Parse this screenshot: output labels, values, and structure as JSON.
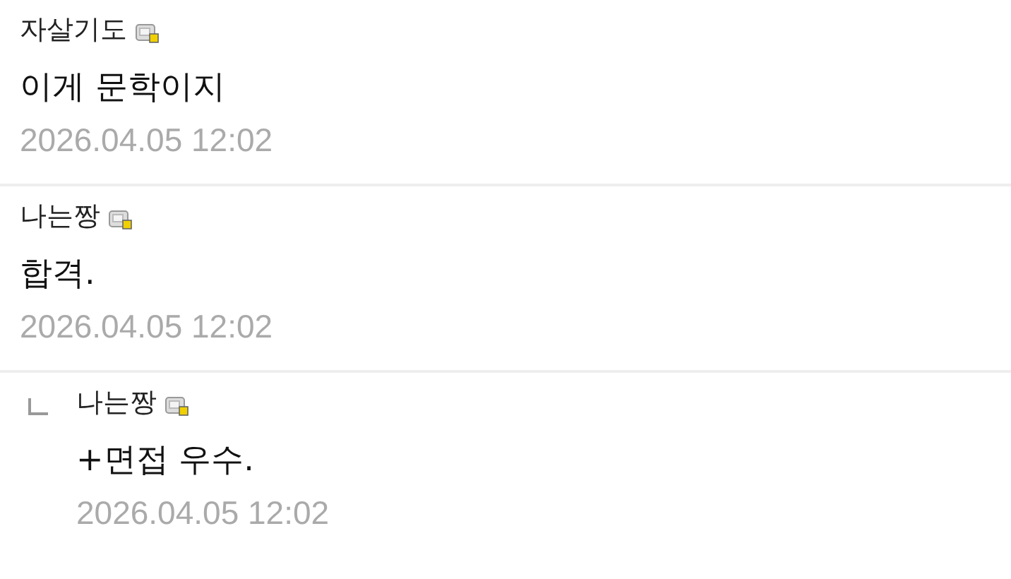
{
  "comments": [
    {
      "kind": "comment",
      "author": "자살기도",
      "text": "이게 문학이지",
      "time": "2026.04.05 12:02"
    },
    {
      "kind": "comment",
      "author": "나는짱",
      "text": "합격.",
      "time": "2026.04.05 12:02"
    },
    {
      "kind": "reply",
      "author": "나는짱",
      "text": "+면접 우수.",
      "time": "2026.04.05 12:02"
    }
  ]
}
